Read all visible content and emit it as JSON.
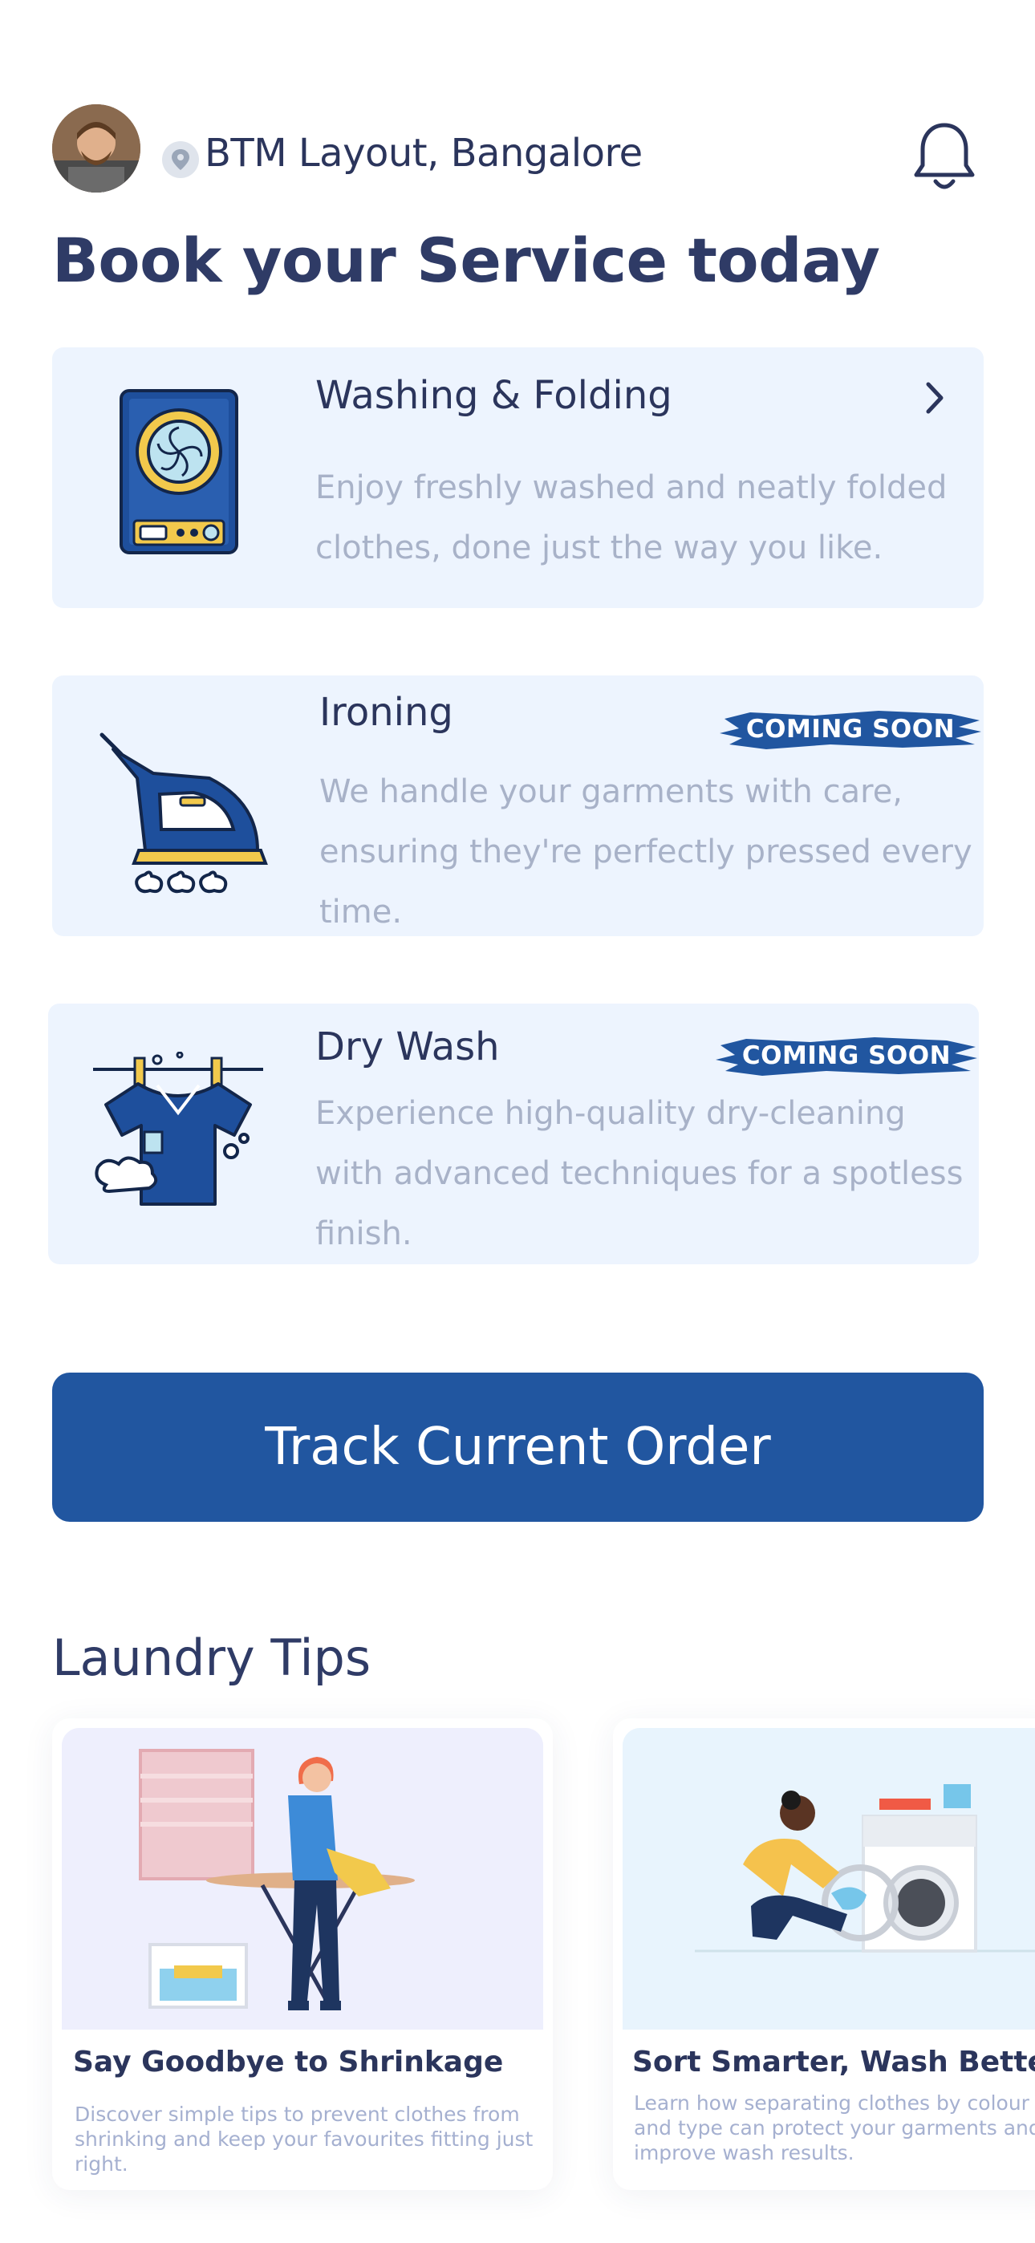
{
  "header": {
    "location": "BTM Layout, Bangalore"
  },
  "page_title": "Book your Service today",
  "services": [
    {
      "title": "Washing & Folding",
      "description": "Enjoy freshly washed and neatly folded clothes, done just the way you like.",
      "icon": "washing-machine-icon"
    },
    {
      "title": "Ironing",
      "badge": "COMING SOON",
      "description": "We handle your garments with care, ensuring they're perfectly pressed every time.",
      "icon": "iron-icon"
    },
    {
      "title": "Dry Wash",
      "badge": "COMING SOON",
      "description": "Experience high-quality dry-cleaning with advanced techniques for a spotless finish.",
      "icon": "shirt-drying-icon"
    }
  ],
  "track_button": "Track Current Order",
  "tips": {
    "heading": "Laundry Tips",
    "items": [
      {
        "title": "Say Goodbye to Shrinkage",
        "description": "Discover simple tips to prevent clothes from shrinking and keep your favourites fitting just right."
      },
      {
        "title": "Sort Smarter, Wash Better",
        "description": "Learn how separating clothes by colour and type can protect your garments and improve wash results."
      }
    ]
  },
  "colors": {
    "primary": "#2156a0",
    "card_bg": "#edf4fe",
    "title_text": "#2f3b66",
    "muted_text": "#a8b2c8"
  }
}
